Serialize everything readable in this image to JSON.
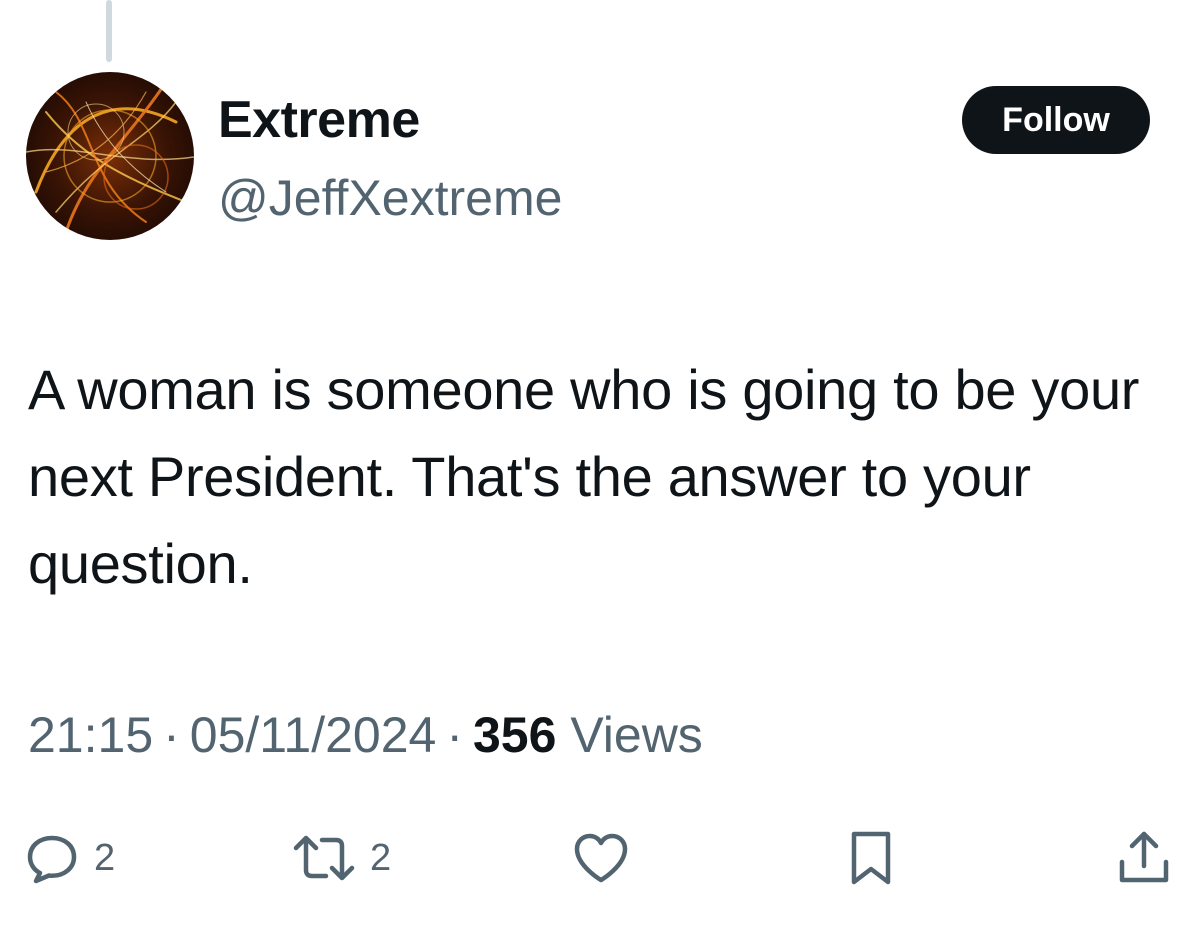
{
  "author": {
    "display_name": "Extreme",
    "handle": "@JeffXextreme",
    "avatar_icon": "fractal-avatar"
  },
  "follow_button": {
    "label": "Follow"
  },
  "tweet": {
    "text": "A woman is someone who is going to be your next President. That's the answer to your question.",
    "time": "21:15",
    "date": "05/11/2024",
    "separator": "·",
    "views_count": "356",
    "views_label": "Views"
  },
  "actions": {
    "reply": {
      "icon": "reply-bubble-icon",
      "count": "2"
    },
    "repost": {
      "icon": "repost-arrows-icon",
      "count": "2"
    },
    "like": {
      "icon": "heart-icon"
    },
    "bookmark": {
      "icon": "bookmark-icon"
    },
    "share": {
      "icon": "share-upload-icon"
    }
  },
  "colors": {
    "text_primary": "#0f1419",
    "text_secondary": "#536471",
    "button_bg": "#0f1419",
    "button_text": "#ffffff",
    "thread_line": "#cfd9de"
  }
}
